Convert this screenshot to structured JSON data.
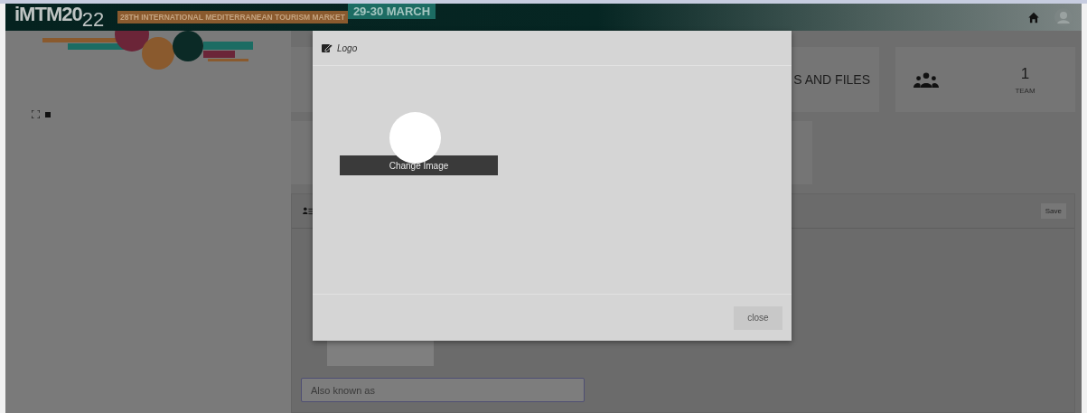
{
  "header": {
    "logo_main": "iMTM20",
    "logo_sub": "22",
    "banner": "28TH INTERNATIONAL MEDITERRANEAN TOURISM MARKET",
    "dates": "29-30 MARCH"
  },
  "cards": [
    {
      "kind": "label",
      "text": "S AND FILES"
    },
    {
      "kind": "stat",
      "value": "1",
      "caption": "TEAM"
    }
  ],
  "panel": {
    "save": "Save",
    "alias": {
      "placeholder": "Also known as"
    }
  },
  "modal": {
    "title": "Logo",
    "change_image": "Change Image",
    "close": "close"
  }
}
